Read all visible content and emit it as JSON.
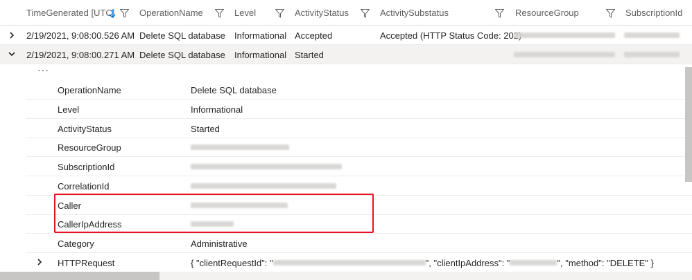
{
  "header": {
    "columns": [
      {
        "label": "TimeGenerated [UTC]",
        "sorted": "descending"
      },
      {
        "label": "OperationName"
      },
      {
        "label": "Level"
      },
      {
        "label": "ActivityStatus"
      },
      {
        "label": "ActivitySubstatus"
      },
      {
        "label": "ResourceGroup"
      },
      {
        "label": "SubscriptionId"
      }
    ]
  },
  "rows": [
    {
      "expanded": false,
      "time": "2/19/2021, 9:08:00.526 AM",
      "operation": "Delete SQL database",
      "level": "Informational",
      "status": "Accepted",
      "substatus": "Accepted (HTTP Status Code: 202)"
    },
    {
      "expanded": true,
      "time": "2/19/2021, 9:08:00.271 AM",
      "operation": "Delete SQL database",
      "level": "Informational",
      "status": "Started",
      "substatus": ""
    }
  ],
  "detail": {
    "ellipsis": "···",
    "fields": [
      {
        "key": "OperationName",
        "value": "Delete SQL database"
      },
      {
        "key": "Level",
        "value": "Informational"
      },
      {
        "key": "ActivityStatus",
        "value": "Started"
      },
      {
        "key": "ResourceGroup",
        "value": ""
      },
      {
        "key": "SubscriptionId",
        "value": ""
      },
      {
        "key": "CorrelationId",
        "value": ""
      },
      {
        "key": "Caller",
        "value": ""
      },
      {
        "key": "CallerIpAddress",
        "value": ""
      },
      {
        "key": "Category",
        "value": "Administrative"
      },
      {
        "key": "HTTPRequest",
        "value_parts": [
          "{ \"clientRequestId\": \"",
          "\", \"clientIpAddress\": \"",
          "\", \"method\": \"DELETE\" }"
        ]
      }
    ]
  },
  "colors": {
    "highlight": "#e81123",
    "sort_arrow": "#0078d4",
    "scrollbar": "#c8c6c4"
  }
}
